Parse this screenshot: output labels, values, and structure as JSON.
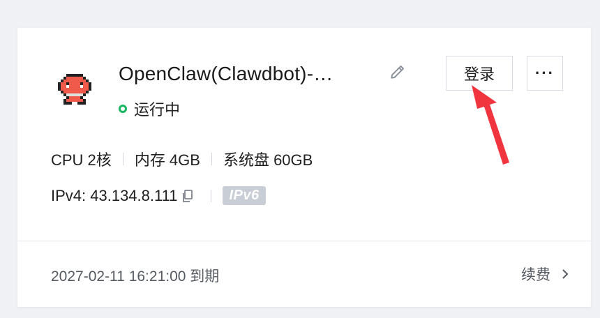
{
  "instance": {
    "name": "OpenClaw(Clawdbot)-…",
    "status": "运行中",
    "status_color": "#18b760"
  },
  "actions": {
    "login_label": "登录",
    "more_label": "···"
  },
  "specs": {
    "cpu": "CPU 2核",
    "memory": "内存 4GB",
    "disk": "系统盘 60GB"
  },
  "network": {
    "ipv4": "IPv4: 43.134.8.111",
    "ipv6_badge": "IPv6"
  },
  "footer": {
    "expire_text": "2027-02-11 16:21:00 到期",
    "renew_label": "续费"
  },
  "icons": [
    "robot-avatar-icon",
    "edit-icon",
    "copy-icon",
    "more-icon",
    "chevron-right-icon",
    "annotation-arrow"
  ],
  "colors": {
    "accent_status": "#18b760",
    "badge_bg": "#c8cdd6",
    "arrow": "#f0353e"
  }
}
